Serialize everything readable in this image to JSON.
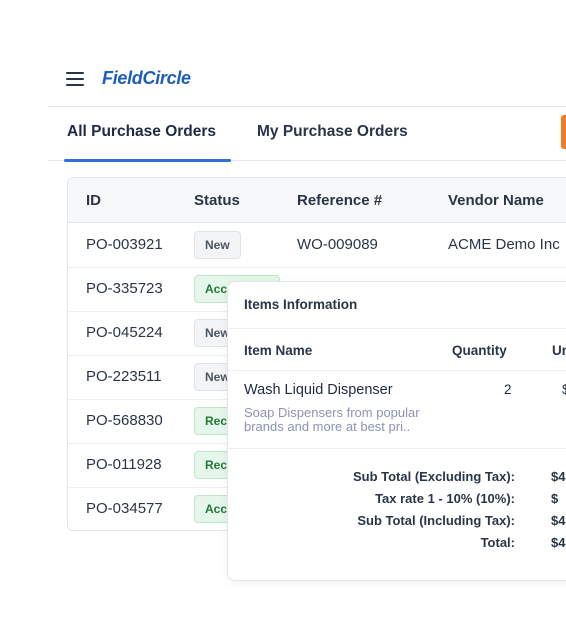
{
  "header": {
    "app_name": "FieldCircle"
  },
  "tabs": [
    {
      "label": "All Purchase Orders",
      "active": true
    },
    {
      "label": "My Purchase Orders",
      "active": false
    }
  ],
  "colors": {
    "accent": "#2f6fd8",
    "brand": "#1e5fb5",
    "action": "#f47b20",
    "status_green": "#1f7a3a"
  },
  "table": {
    "columns": [
      "ID",
      "Status",
      "Reference #",
      "Vendor Name"
    ],
    "rows": [
      {
        "id": "PO-003921",
        "status": "New",
        "status_kind": "new",
        "reference": "WO-009089",
        "vendor": "ACME Demo Inc"
      },
      {
        "id": "PO-335723",
        "status": "Acc",
        "status_kind": "green",
        "reference": "",
        "vendor": ""
      },
      {
        "id": "PO-045224",
        "status": "New",
        "status_kind": "new",
        "reference": "",
        "vendor": ""
      },
      {
        "id": "PO-223511",
        "status": "New",
        "status_kind": "new",
        "reference": "",
        "vendor": ""
      },
      {
        "id": "PO-568830",
        "status": "Rec",
        "status_kind": "green",
        "reference": "",
        "vendor": ""
      },
      {
        "id": "PO-011928",
        "status": "Rec",
        "status_kind": "green",
        "reference": "",
        "vendor": ""
      },
      {
        "id": "PO-034577",
        "status": "Acc",
        "status_kind": "green",
        "reference": "",
        "vendor": ""
      }
    ]
  },
  "popup": {
    "title": "Items Information",
    "columns": [
      "Item Name",
      "Quantity",
      "Un"
    ],
    "item": {
      "name": "Wash Liquid Dispenser",
      "quantity": "2",
      "unit": "$",
      "description": "Soap Dispensers from popular brands and more at best pri.."
    },
    "summary": [
      {
        "label": "Sub Total (Excluding Tax):",
        "value": "$4"
      },
      {
        "label": "Tax rate 1 - 10% (10%):",
        "value": "$"
      },
      {
        "label": "Sub Total (Including Tax):",
        "value": "$4"
      },
      {
        "label": "Total:",
        "value": "$4"
      }
    ]
  }
}
